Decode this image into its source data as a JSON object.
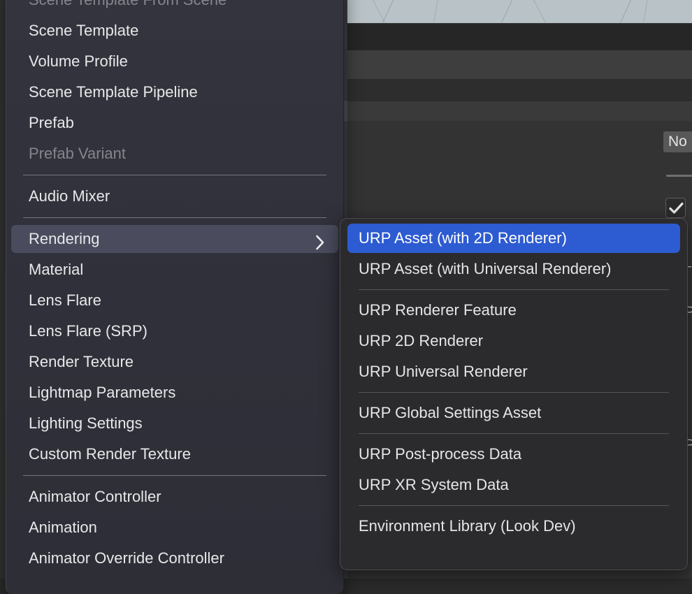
{
  "background": {
    "scene_viewport": {
      "name": "scene-view-grid"
    },
    "object_field": {
      "value": "No"
    },
    "checkbox": {
      "checked": true,
      "glyph": "check-icon"
    },
    "right_edge_glyphs": [
      "⌐",
      "⊃",
      "⊃"
    ]
  },
  "main_menu": {
    "name": "create-asset-menu",
    "items": [
      {
        "label": "Scene Template From Scene",
        "type": "item",
        "state": "disabled"
      },
      {
        "label": "Scene Template",
        "type": "item",
        "state": "normal"
      },
      {
        "label": "Volume Profile",
        "type": "item",
        "state": "normal"
      },
      {
        "label": "Scene Template Pipeline",
        "type": "item",
        "state": "normal"
      },
      {
        "label": "Prefab",
        "type": "item",
        "state": "normal"
      },
      {
        "label": "Prefab Variant",
        "type": "item",
        "state": "disabled"
      },
      {
        "type": "separator"
      },
      {
        "label": "Audio Mixer",
        "type": "item",
        "state": "normal"
      },
      {
        "type": "separator"
      },
      {
        "label": "Rendering",
        "type": "submenu",
        "state": "highlighted",
        "arrow": "chevron-right-icon"
      },
      {
        "label": "Material",
        "type": "item",
        "state": "normal"
      },
      {
        "label": "Lens Flare",
        "type": "item",
        "state": "normal"
      },
      {
        "label": "Lens Flare (SRP)",
        "type": "item",
        "state": "normal"
      },
      {
        "label": "Render Texture",
        "type": "item",
        "state": "normal"
      },
      {
        "label": "Lightmap Parameters",
        "type": "item",
        "state": "normal"
      },
      {
        "label": "Lighting Settings",
        "type": "item",
        "state": "normal"
      },
      {
        "label": "Custom Render Texture",
        "type": "item",
        "state": "normal"
      },
      {
        "type": "separator"
      },
      {
        "label": "Animator Controller",
        "type": "item",
        "state": "normal"
      },
      {
        "label": "Animation",
        "type": "item",
        "state": "normal"
      },
      {
        "label": "Animator Override Controller",
        "type": "item",
        "state": "normal"
      }
    ]
  },
  "sub_menu": {
    "name": "rendering-submenu",
    "parent": "Rendering",
    "items": [
      {
        "label": "URP Asset (with 2D Renderer)",
        "type": "item",
        "state": "selected"
      },
      {
        "label": "URP Asset (with Universal Renderer)",
        "type": "item",
        "state": "normal"
      },
      {
        "type": "separator"
      },
      {
        "label": "URP Renderer Feature",
        "type": "item",
        "state": "normal"
      },
      {
        "label": "URP 2D Renderer",
        "type": "item",
        "state": "normal"
      },
      {
        "label": "URP Universal Renderer",
        "type": "item",
        "state": "normal"
      },
      {
        "type": "separator"
      },
      {
        "label": "URP Global Settings Asset",
        "type": "item",
        "state": "normal"
      },
      {
        "type": "separator"
      },
      {
        "label": "URP Post-process Data",
        "type": "item",
        "state": "normal"
      },
      {
        "label": "URP XR System Data",
        "type": "item",
        "state": "normal"
      },
      {
        "type": "separator"
      },
      {
        "label": "Environment Library (Look Dev)",
        "type": "item",
        "state": "normal"
      }
    ]
  },
  "colors": {
    "menu_background": "#32323c",
    "submenu_background": "#2b2b2e",
    "selection_blue": "#2d5bd1",
    "hover_gray": "#4a4c5e",
    "text": "#e8e8ea",
    "text_disabled": "#85858c",
    "viewport": "#b9c3c7"
  }
}
